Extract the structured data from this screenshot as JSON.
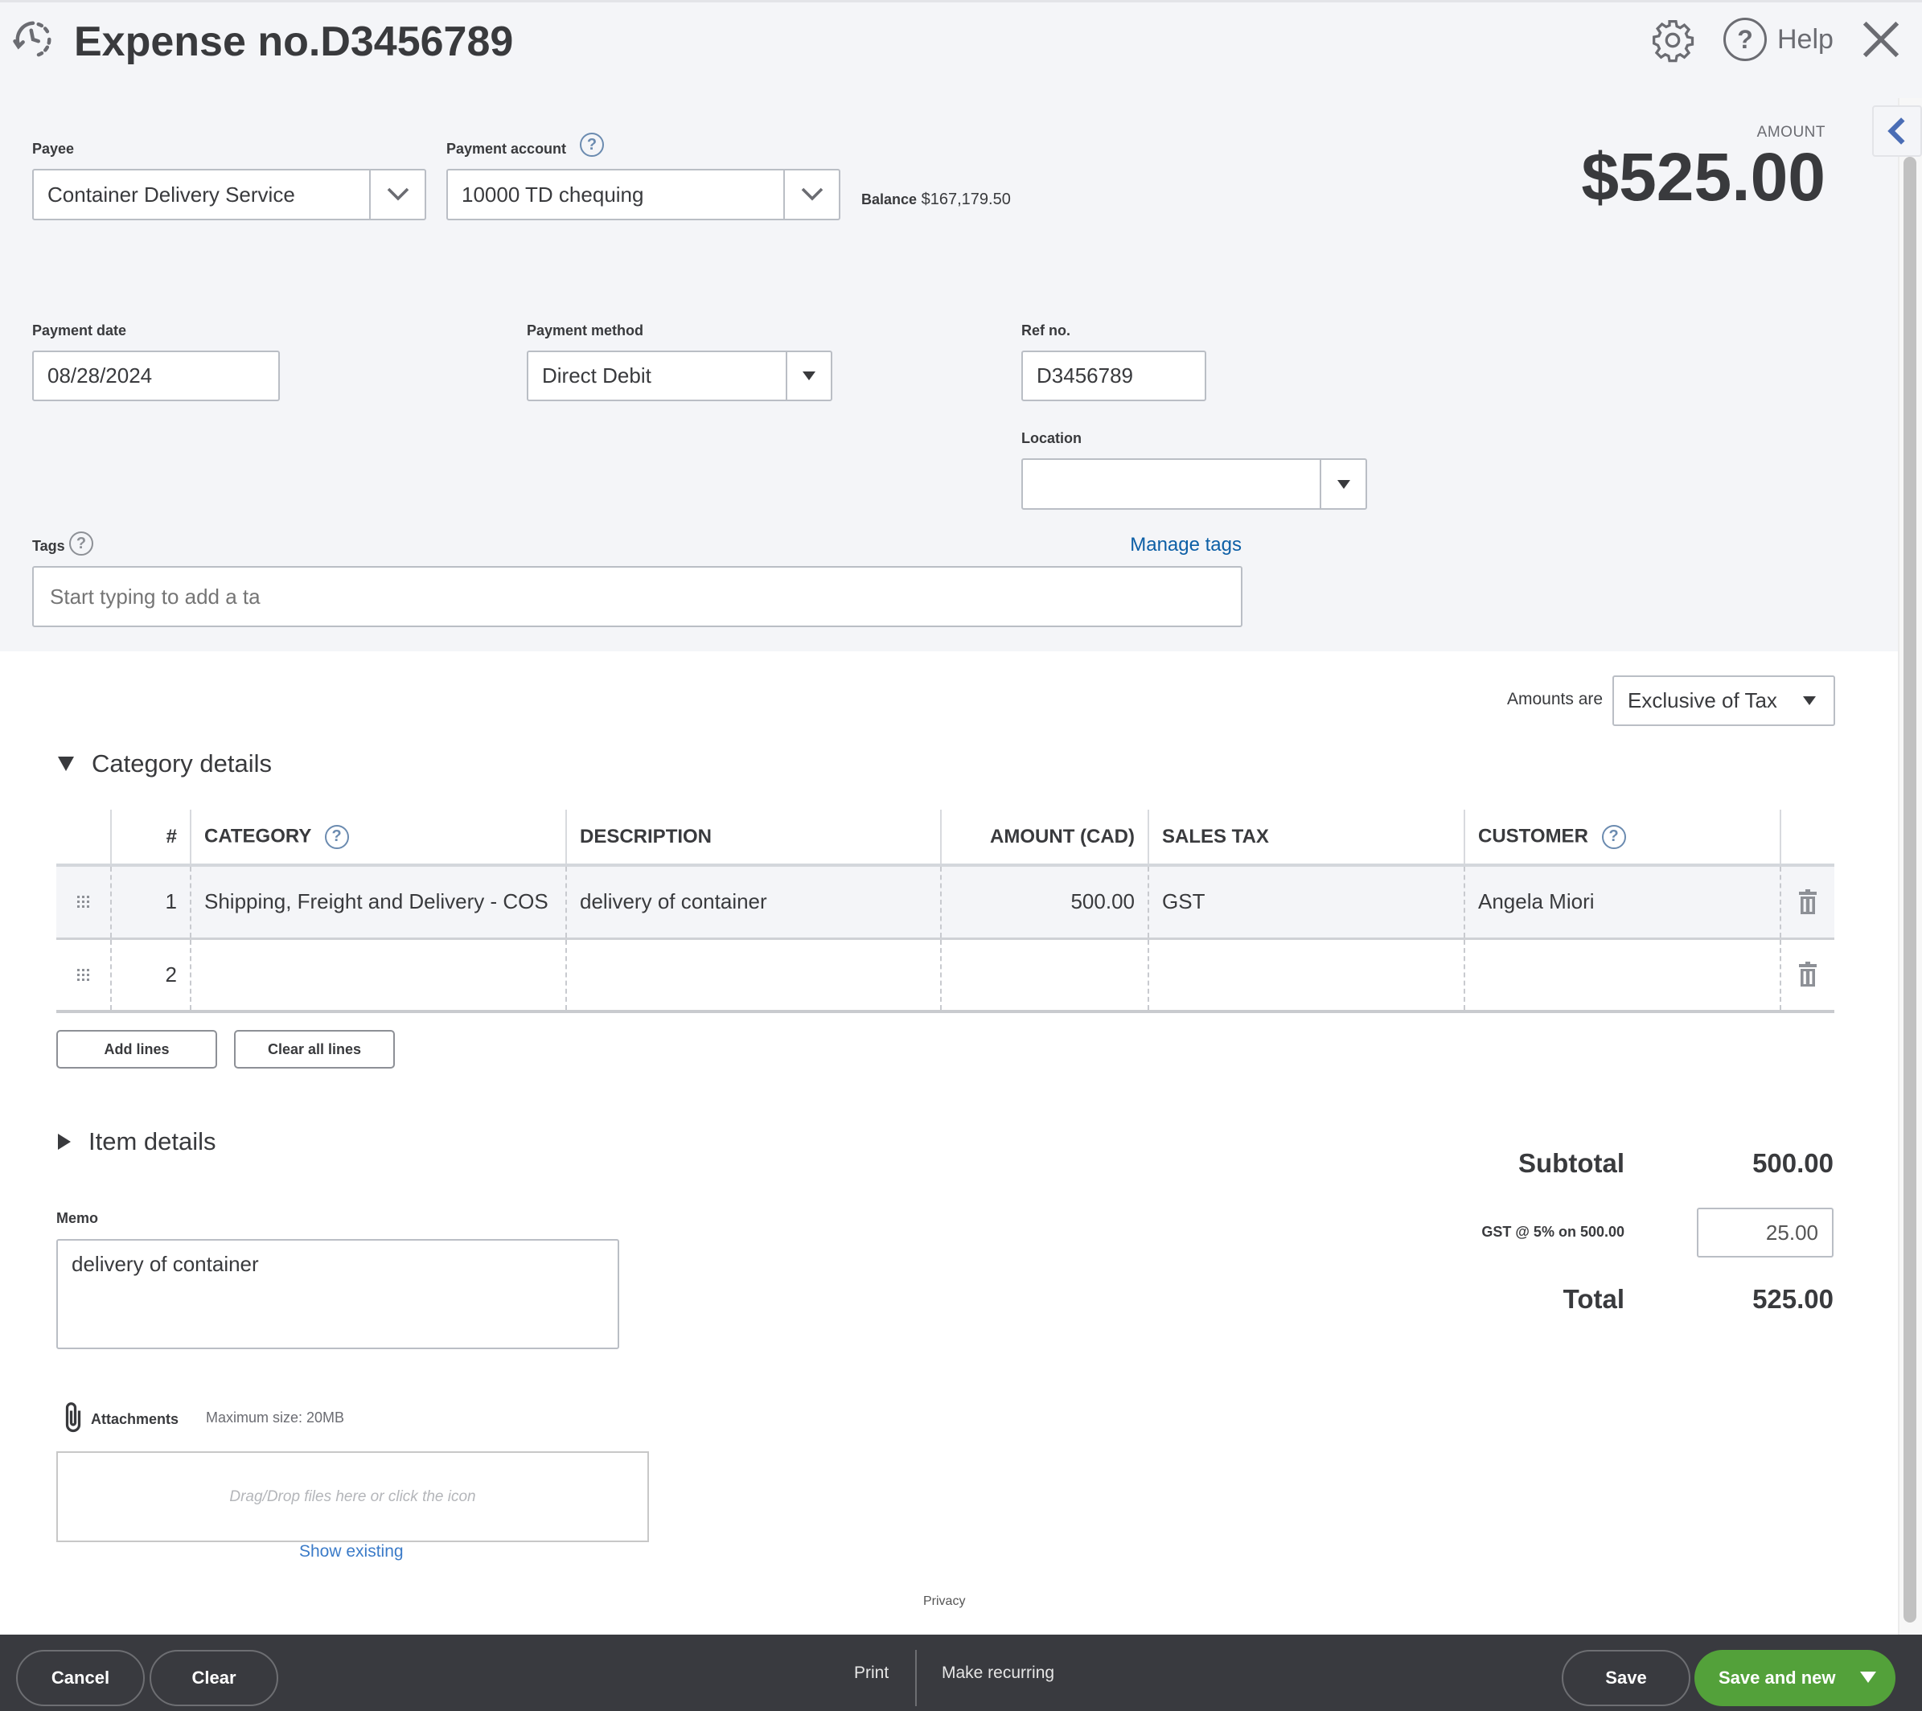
{
  "header": {
    "title": "Expense no.D3456789",
    "help_label": "Help",
    "icons": {
      "history": "history-clock-icon",
      "settings": "gear-icon",
      "help": "question-circle-icon",
      "close": "close-icon"
    }
  },
  "amount": {
    "label": "AMOUNT",
    "value": "$525.00"
  },
  "payee": {
    "label": "Payee",
    "value": "Container Delivery Service"
  },
  "payment_account": {
    "label": "Payment account",
    "value": "10000 TD chequing",
    "balance_label": "Balance",
    "balance_value": "$167,179.50"
  },
  "payment_date": {
    "label": "Payment date",
    "value": "08/28/2024"
  },
  "payment_method": {
    "label": "Payment method",
    "value": "Direct Debit"
  },
  "ref_no": {
    "label": "Ref no.",
    "value": "D3456789"
  },
  "location": {
    "label": "Location",
    "value": ""
  },
  "tags": {
    "label": "Tags",
    "placeholder": "Start typing to add a ta",
    "manage_link": "Manage tags"
  },
  "amounts_are": {
    "label": "Amounts are",
    "value": "Exclusive of Tax"
  },
  "category_details": {
    "title": "Category details",
    "columns": [
      "#",
      "CATEGORY",
      "DESCRIPTION",
      "AMOUNT (CAD)",
      "SALES TAX",
      "CUSTOMER"
    ],
    "rows": [
      {
        "num": "1",
        "category": "Shipping, Freight and Delivery - COS",
        "description": "delivery of container",
        "amount": "500.00",
        "sales_tax": "GST",
        "customer": "Angela Miori"
      },
      {
        "num": "2",
        "category": "",
        "description": "",
        "amount": "",
        "sales_tax": "",
        "customer": ""
      }
    ],
    "add_lines": "Add lines",
    "clear_all_lines": "Clear all lines"
  },
  "item_details": {
    "title": "Item details"
  },
  "totals": {
    "subtotal_label": "Subtotal",
    "subtotal_value": "500.00",
    "tax_label": "GST @ 5% on 500.00",
    "tax_value": "25.00",
    "total_label": "Total",
    "total_value": "525.00"
  },
  "memo": {
    "label": "Memo",
    "value": "delivery of container"
  },
  "attachments": {
    "label": "Attachments",
    "max_size": "Maximum size: 20MB",
    "dropzone_text": "Drag/Drop files here or click the icon",
    "show_existing": "Show existing"
  },
  "privacy": "Privacy",
  "footer": {
    "cancel": "Cancel",
    "clear": "Clear",
    "print": "Print",
    "make_recurring": "Make recurring",
    "save": "Save",
    "save_and_new": "Save and new"
  },
  "colors": {
    "accent_green": "#53a13a",
    "link_blue": "#0d5fa6",
    "footer_bg": "#393a3f",
    "top_bg": "#f4f5f8"
  }
}
